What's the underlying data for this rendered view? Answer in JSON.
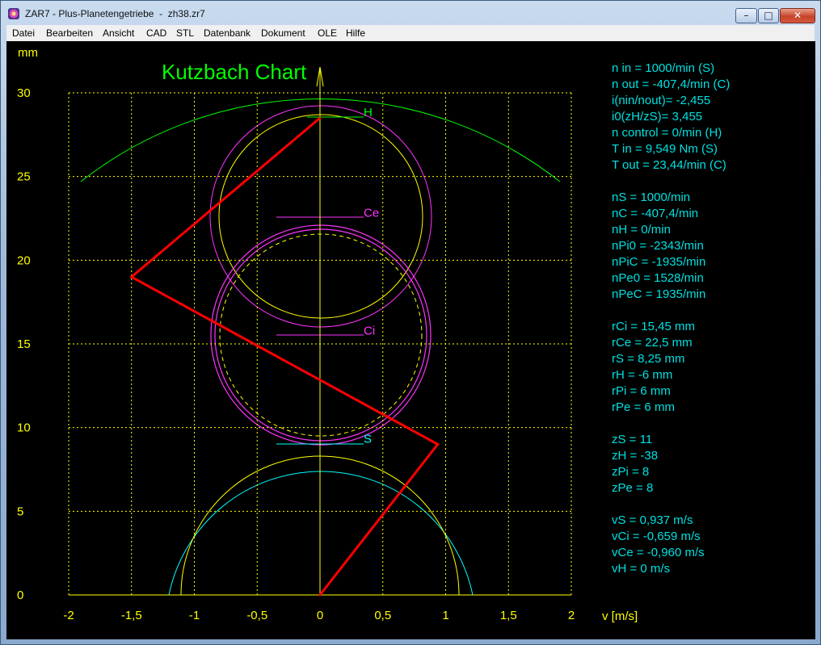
{
  "window": {
    "title": "ZAR7 - Plus-Planetengetriebe  -  zh38.zr7",
    "min_glyph": "–",
    "max_glyph": "□",
    "close_glyph": "✕"
  },
  "menu": [
    "Datei",
    "Bearbeiten",
    "Ansicht",
    "CAD",
    "STL",
    "Datenbank",
    "Dokument",
    "OLE",
    "Hilfe"
  ],
  "chart_data": {
    "type": "line",
    "title": "Kutzbach Chart",
    "xlabel": "v [m/s]",
    "ylabel": "mm",
    "xlim": [
      -2,
      2
    ],
    "ylim": [
      0,
      30
    ],
    "grid": true,
    "x_ticks": [
      "-2",
      "-1,5",
      "-1",
      "-0,5",
      "0",
      "0,5",
      "1",
      "1,5",
      "2"
    ],
    "y_ticks": [
      "0",
      "5",
      "10",
      "15",
      "20",
      "25",
      "30"
    ],
    "series": [
      {
        "name": "",
        "color": "#ff0000",
        "points": [
          [
            0,
            0
          ],
          [
            0.937,
            9.0
          ],
          [
            -1.5,
            19.0
          ],
          [
            0,
            28.5
          ]
        ]
      }
    ],
    "gear_labels": [
      {
        "text": "H",
        "color": "#00ff00",
        "x": 0.0,
        "y": 28.5
      },
      {
        "text": "Ce",
        "color": "#ff33ff",
        "x": 0.0,
        "y": 22.5
      },
      {
        "text": "Ci",
        "color": "#ff33ff",
        "x": 0.0,
        "y": 15.45
      },
      {
        "text": "S",
        "color": "#00ffff",
        "x": 0.0,
        "y": 9.0
      }
    ],
    "colors": {
      "grid": "#ffff00",
      "axes": "#ffff00",
      "text": "#00e0e0",
      "title": "#00ff00"
    }
  },
  "info": [
    "n in = 1000/min (S)",
    "n out = -407,4/min (C)",
    "i(nin/nout)= -2,455",
    "i0(zH/zS)= 3,455",
    "n control = 0/min (H)",
    "T in = 9,549 Nm (S)",
    "T out = 23,44/min (C)",
    "",
    "nS = 1000/min",
    "nC = -407,4/min",
    "nH = 0/min",
    "nPi0 = -2343/min",
    "nPiC = -1935/min",
    "nPe0 = 1528/min",
    "nPeC = 1935/min",
    "",
    "rCi = 15,45 mm",
    "rCe = 22,5 mm",
    "rS = 8,25 mm",
    "rH = -6 mm",
    "rPi = 6 mm",
    "rPe = 6 mm",
    "",
    "zS = 11",
    "zH = -38",
    "zPi = 8",
    "zPe = 8",
    "",
    "vS = 0,937 m/s",
    "vCi = -0,659 m/s",
    "vCe = -0,960 m/s",
    "vH = 0 m/s"
  ]
}
